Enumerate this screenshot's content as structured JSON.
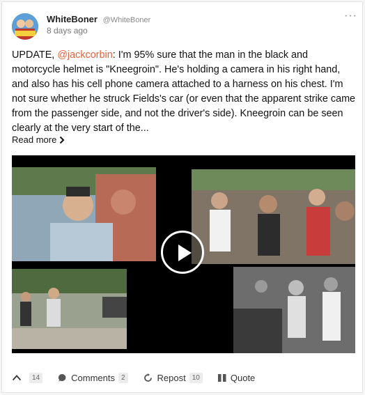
{
  "post": {
    "author_name": "WhiteBoner",
    "author_handle": "@WhiteBoner",
    "timestamp": "8 days ago",
    "avatar_text": "#WhiteBoner",
    "text_prefix": "UPDATE, ",
    "mention": "@jackcorbin",
    "text_body": ": I'm 95% sure that the man in the black and motorcycle helmet is \"Kneegroin\". He's holding a camera in his right hand, and also has his cell phone camera attached to a harness on his chest. I'm not sure whether he struck Fields's car (or even that the apparent strike came from the passenger side, and not the driver's side). Kneegroin can be seen clearly at the very start of the...",
    "read_more": "Read more",
    "more_menu": "···"
  },
  "actions": {
    "upvote_count": "14",
    "comments_label": "Comments",
    "comments_count": "2",
    "repost_label": "Repost",
    "repost_count": "10",
    "quote_label": "Quote"
  },
  "colors": {
    "mention": "#e8613a",
    "count_bg": "#ececec"
  }
}
